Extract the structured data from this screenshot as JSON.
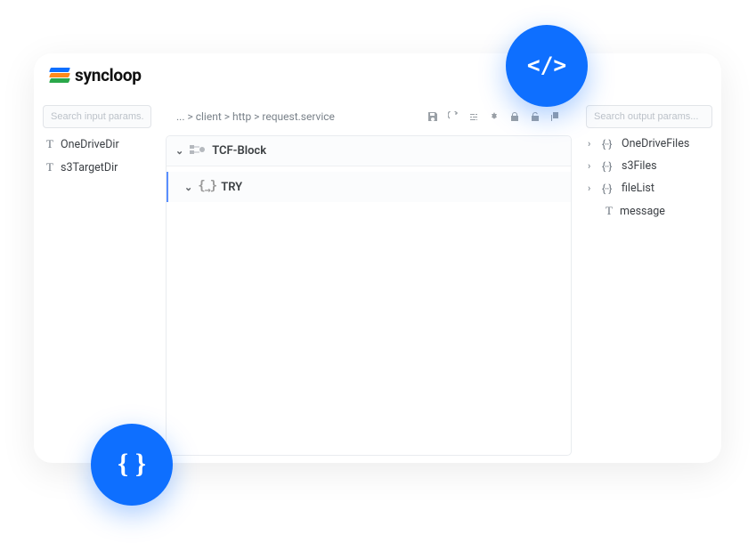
{
  "brand": {
    "name": "syncloop"
  },
  "left": {
    "search_placeholder": "Search input params...",
    "params": [
      {
        "label": "OneDriveDir"
      },
      {
        "label": "s3TargetDir"
      }
    ]
  },
  "right": {
    "search_placeholder": "Search output params...",
    "params": [
      {
        "kind": "object",
        "label": "OneDriveFiles"
      },
      {
        "kind": "object",
        "label": "s3Files"
      },
      {
        "kind": "object",
        "label": "fileList"
      },
      {
        "kind": "text",
        "label": "message",
        "nested": true
      }
    ]
  },
  "main": {
    "breadcrumb": "... > client > http > request.service",
    "blocks": [
      {
        "label": "TCF-Block"
      },
      {
        "label": "TRY"
      }
    ]
  },
  "toolbar_icons": {
    "save": "save",
    "refresh": "refresh",
    "settings": "settings",
    "configure": "configure",
    "lock": "lock",
    "lock_open": "lock-open",
    "copy": "copy"
  }
}
